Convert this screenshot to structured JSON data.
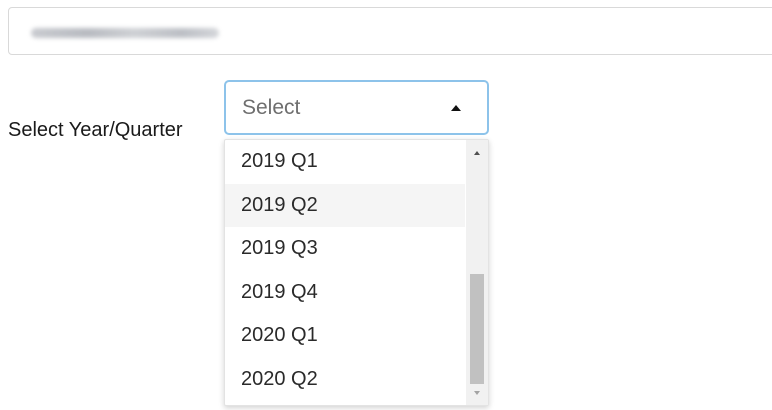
{
  "form": {
    "label": "Select Year/Quarter",
    "select": {
      "value": "Select",
      "options": [
        "2019 Q1",
        "2019 Q2",
        "2019 Q3",
        "2019 Q4",
        "2020 Q1",
        "2020 Q2"
      ]
    }
  }
}
